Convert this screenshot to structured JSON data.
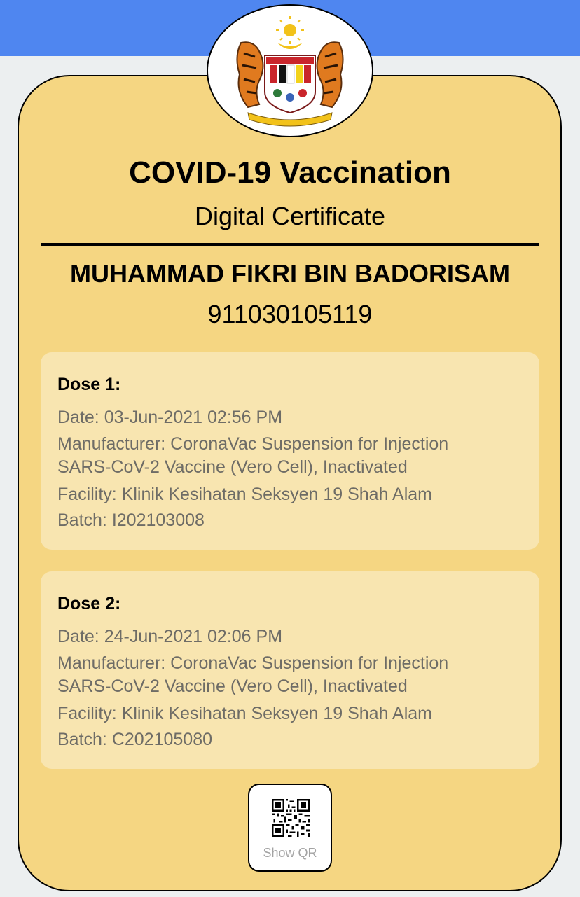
{
  "header": {
    "bar_color": "#4f86f0"
  },
  "emblem": {
    "icon": "malaysia-coat-of-arms-icon"
  },
  "certificate": {
    "title": "COVID-19 Vaccination",
    "subtitle": "Digital Certificate",
    "holder_name": "MUHAMMAD FIKRI BIN BADORISAM",
    "id_number": "911030105119",
    "card_color": "#f5d682",
    "panel_color": "#f8e5b0"
  },
  "doses": [
    {
      "title": "Dose 1:",
      "date": "Date: 03-Jun-2021 02:56 PM",
      "manufacturer_line1": "Manufacturer: CoronaVac Suspension for Injection",
      "manufacturer_line2": "SARS-CoV-2 Vaccine (Vero Cell), Inactivated",
      "facility": "Facility: Klinik Kesihatan Seksyen 19 Shah Alam",
      "batch": "Batch: I202103008"
    },
    {
      "title": "Dose 2:",
      "date": "Date: 24-Jun-2021 02:06 PM",
      "manufacturer_line1": "Manufacturer: CoronaVac Suspension for Injection",
      "manufacturer_line2": "SARS-CoV-2 Vaccine (Vero Cell), Inactivated",
      "facility": "Facility: Klinik Kesihatan Seksyen 19 Shah Alam",
      "batch": "Batch: C202105080"
    }
  ],
  "qr_button": {
    "label": "Show QR",
    "icon": "qr-code-icon"
  }
}
